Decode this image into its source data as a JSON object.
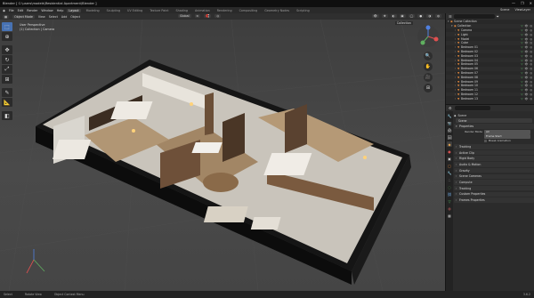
{
  "window": {
    "title": "Blender [ C:\\users\\models\\Residential Apartment\\Blender ]",
    "controls": [
      "—",
      "❐",
      "✕"
    ]
  },
  "menubar": {
    "menus": [
      "File",
      "Edit",
      "Render",
      "Window",
      "Help"
    ],
    "workspaces": [
      "Layout",
      "Modeling",
      "Sculpting",
      "UV Editing",
      "Texture Paint",
      "Shading",
      "Animation",
      "Rendering",
      "Compositing",
      "Geometry Nodes",
      "Scripting"
    ],
    "active_workspace": "Layout",
    "scene_label": "Scene",
    "view_layer_label": "ViewLayer"
  },
  "viewport_header": {
    "mode": "Object Mode",
    "menus": [
      "View",
      "Select",
      "Add",
      "Object"
    ],
    "transform": "Global",
    "collection_tag": "Collection"
  },
  "viewport_info": {
    "line1": "User Perspective",
    "line2": "(1) Collection | Camera"
  },
  "toolbar": {
    "tools": [
      {
        "name": "select-box-tool",
        "glyph": "⬚",
        "active": true
      },
      {
        "name": "cursor-tool",
        "glyph": "⊕",
        "active": false
      },
      {
        "name": "move-tool",
        "glyph": "✥",
        "active": false
      },
      {
        "name": "rotate-tool",
        "glyph": "↻",
        "active": false
      },
      {
        "name": "scale-tool",
        "glyph": "⤢",
        "active": false
      },
      {
        "name": "transform-tool",
        "glyph": "⊞",
        "active": false
      },
      {
        "name": "annotate-tool",
        "glyph": "✎",
        "active": false
      },
      {
        "name": "measure-tool",
        "glyph": "📐",
        "active": false
      },
      {
        "name": "add-cube-tool",
        "glyph": "◧",
        "active": false
      }
    ]
  },
  "nav_icons": [
    "🔍",
    "✋",
    "🎥",
    "⊞"
  ],
  "outliner": {
    "rows": [
      {
        "name": "Scene Collection",
        "depth": 0,
        "icon": "▣"
      },
      {
        "name": "Collection",
        "depth": 1,
        "icon": "▣"
      },
      {
        "name": "Camera",
        "depth": 2,
        "icon": "▼"
      },
      {
        "name": "Light",
        "depth": 2,
        "icon": "▼"
      },
      {
        "name": "Model",
        "depth": 2,
        "icon": "▼"
      },
      {
        "name": "Cube",
        "depth": 2,
        "icon": "▼"
      },
      {
        "name": "Bedroom 01",
        "depth": 2,
        "icon": "▼"
      },
      {
        "name": "Bedroom 02",
        "depth": 2,
        "icon": "▼"
      },
      {
        "name": "Bedroom 03",
        "depth": 2,
        "icon": "▼"
      },
      {
        "name": "Bedroom 04",
        "depth": 2,
        "icon": "▼"
      },
      {
        "name": "Bedroom 05",
        "depth": 2,
        "icon": "▼"
      },
      {
        "name": "Bedroom 06",
        "depth": 2,
        "icon": "▼"
      },
      {
        "name": "Bedroom 07",
        "depth": 2,
        "icon": "▼"
      },
      {
        "name": "Bedroom 08",
        "depth": 2,
        "icon": "▼"
      },
      {
        "name": "Bedroom 09",
        "depth": 2,
        "icon": "▼"
      },
      {
        "name": "Bedroom 10",
        "depth": 2,
        "icon": "▼"
      },
      {
        "name": "Bedroom 11",
        "depth": 2,
        "icon": "▼"
      },
      {
        "name": "Bedroom 12",
        "depth": 2,
        "icon": "▼"
      },
      {
        "name": "Bedroom 13",
        "depth": 2,
        "icon": "▼"
      }
    ]
  },
  "properties": {
    "path_scene": "Scene",
    "object_field": "Scene",
    "panels": [
      {
        "title": "Properties",
        "open": true
      },
      {
        "title": "Tracking",
        "open": false
      },
      {
        "title": "Active Clip",
        "open": false
      },
      {
        "title": "Rigid Body",
        "open": false
      },
      {
        "title": "Audio & Motion",
        "open": false
      },
      {
        "title": "Gravity",
        "open": false
      },
      {
        "title": "Scene Cameras",
        "open": false
      },
      {
        "title": "Compute",
        "open": false
      },
      {
        "title": "Tracking",
        "open": false
      },
      {
        "title": "Custom Properties",
        "open": false
      },
      {
        "title": "Frames Properties",
        "open": false
      }
    ],
    "rows": [
      {
        "label": "Render Mode",
        "value": "All"
      },
      {
        "label": "",
        "value": "Frame Start"
      },
      {
        "label": "",
        "value": "Break Animation",
        "checkbox": true
      }
    ]
  },
  "statusbar": {
    "items": [
      "Select",
      "Rotate View",
      "Object Context Menu"
    ],
    "version": "3.6.2"
  }
}
